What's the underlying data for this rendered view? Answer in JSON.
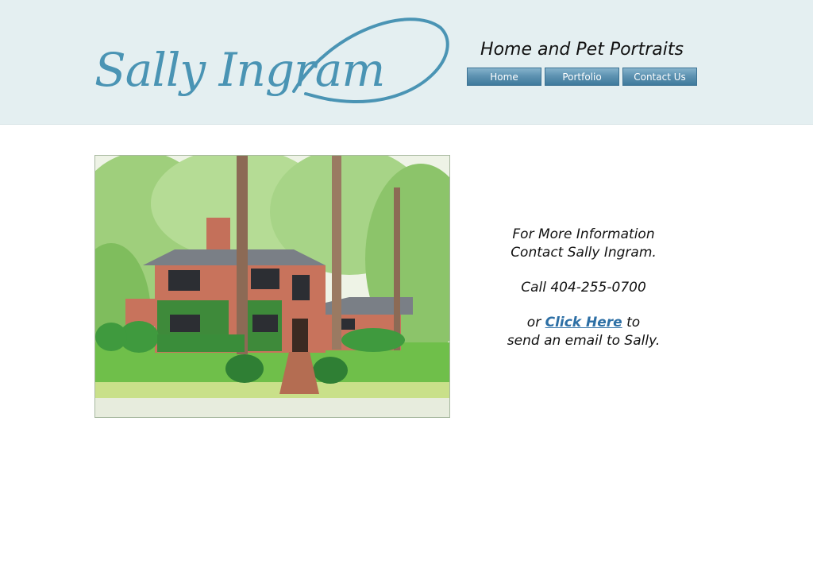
{
  "header": {
    "logo_text": "Sally Ingram",
    "tagline": "Home and Pet Portraits"
  },
  "nav": {
    "items": [
      {
        "label": "Home"
      },
      {
        "label": "Portfolio"
      },
      {
        "label": "Contact Us"
      }
    ]
  },
  "contact": {
    "line1": "For More Information",
    "line2": "Contact Sally Ingram.",
    "phone": "Call 404-255-0700",
    "or_text": "or ",
    "link_text": "Click Here",
    "to_text": " to",
    "email_line": "send an email to Sally."
  },
  "colors": {
    "header_bg": "#e4eff1",
    "logo": "#4a94b4",
    "nav_button": "#5e93b2",
    "link": "#2d6fa5"
  }
}
